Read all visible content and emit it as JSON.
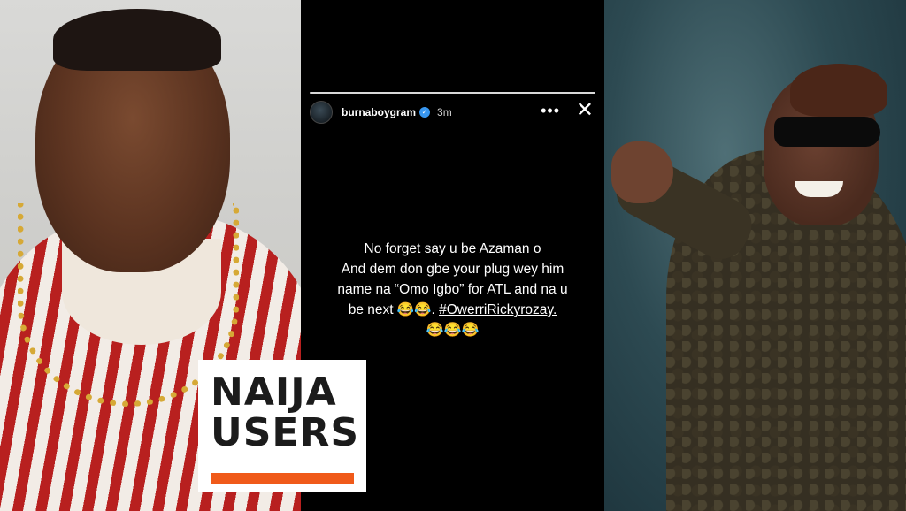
{
  "story": {
    "username": "burnaboygram",
    "time": "3m",
    "more_icon": "more-horizontal-icon",
    "close_icon": "close-icon",
    "verified_icon": "verified-badge-icon",
    "caption_lines": [
      "No forget say u be Azaman o",
      "And dem don gbe your plug wey him",
      "name na “Omo Igbo” for ATL and na u",
      "be next  😂😂.  ",
      "😂😂😂"
    ],
    "hashtag": "#OwerriRickyrozay."
  },
  "logo": {
    "line1": "NAIJA",
    "line2": "USERS",
    "accent_color": "#f05a1a"
  }
}
